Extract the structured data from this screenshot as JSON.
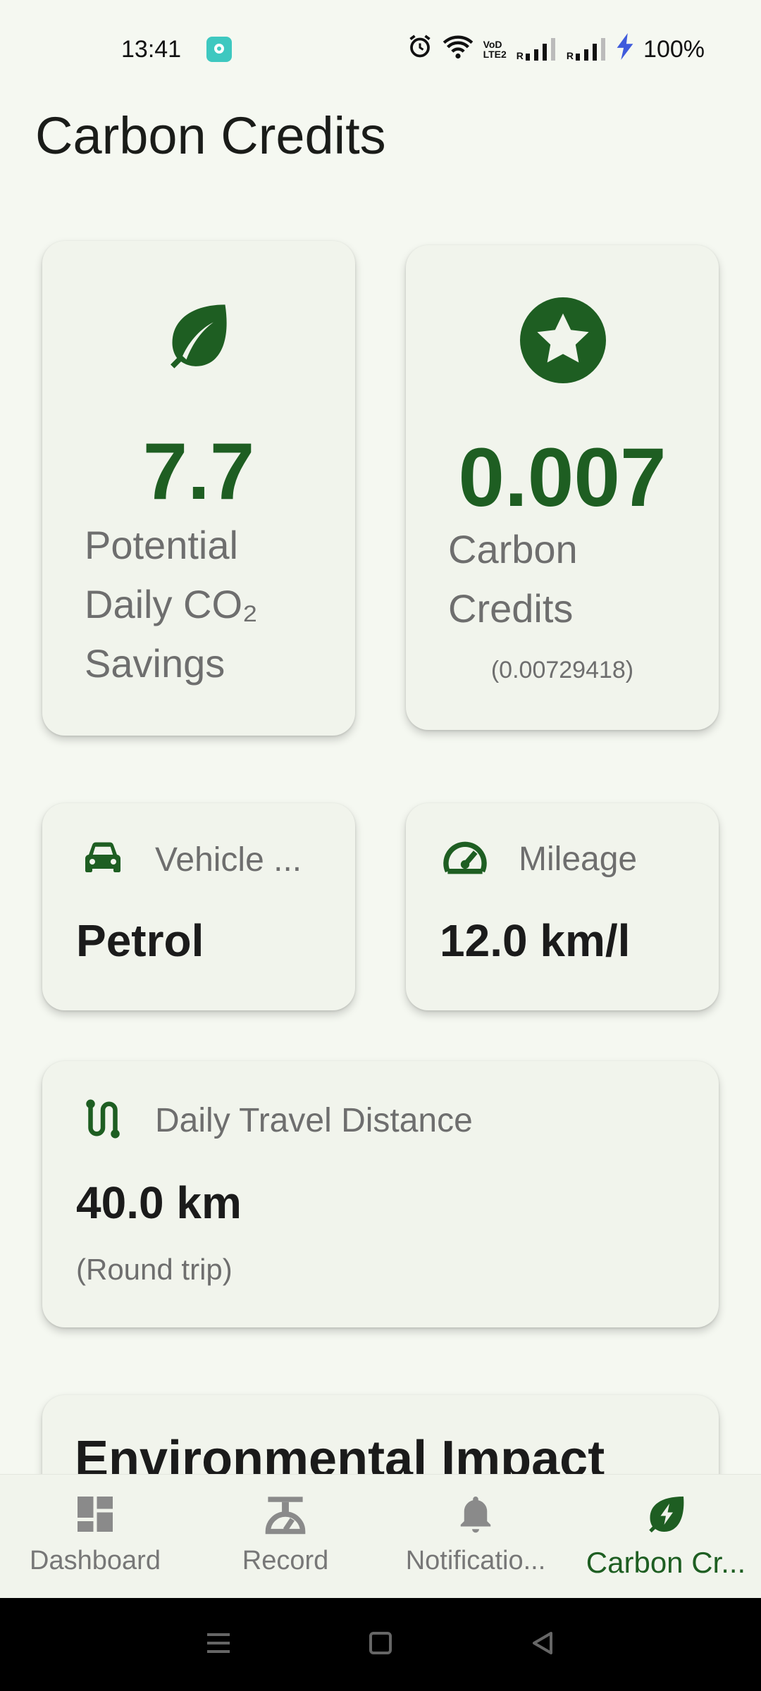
{
  "status_bar": {
    "time": "13:41",
    "network_label_top": "VoD",
    "network_label_bottom": "LTE2",
    "sim1_label": "R",
    "sim2_label": "R",
    "battery": "100%"
  },
  "page": {
    "title": "Carbon Credits"
  },
  "savings_card": {
    "value": "7.7",
    "label_line1": "Potential",
    "label_line2": "Daily CO₂",
    "label_line3": "Savings",
    "icon": "leaf-icon"
  },
  "credits_card": {
    "value": "0.007",
    "label_line1": "Carbon",
    "label_line2": "Credits",
    "exact_value": "(0.00729418)",
    "icon": "star-badge-icon"
  },
  "vehicle_card": {
    "title": "Vehicle ...",
    "value": "Petrol",
    "icon": "car-icon"
  },
  "mileage_card": {
    "title": "Mileage",
    "value": "12.0 km/l",
    "icon": "speedometer-icon"
  },
  "distance_card": {
    "title": "Daily Travel Distance",
    "value": "40.0 km",
    "note": "(Round trip)",
    "icon": "route-icon"
  },
  "impact_card": {
    "title": "Environmental Impact"
  },
  "bottom_nav": {
    "items": [
      {
        "label": "Dashboard",
        "icon": "dashboard-icon"
      },
      {
        "label": "Record",
        "icon": "scale-icon"
      },
      {
        "label": "Notificatio...",
        "icon": "bell-icon"
      },
      {
        "label": "Carbon Cr...",
        "icon": "eco-bolt-icon"
      }
    ],
    "active_index": 3
  },
  "colors": {
    "accent_green": "#1e5e22",
    "card_bg": "#f1f4ec",
    "page_bg": "#f5f8f1",
    "muted_text": "#6e6e6e"
  }
}
